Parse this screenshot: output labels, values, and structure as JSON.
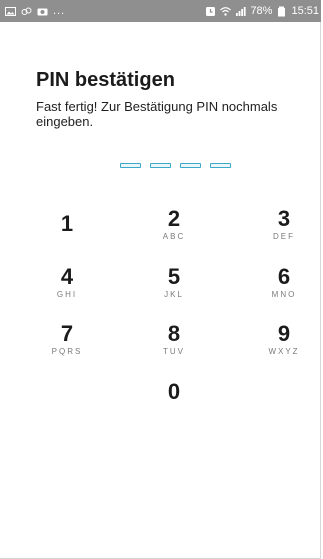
{
  "status_bar": {
    "dots": "...",
    "battery_text": "78%",
    "time": "15:51",
    "icons": [
      "image-icon",
      "link-icon",
      "camera-icon",
      "alarm-icon",
      "wifi-icon",
      "signal-icon",
      "battery-icon"
    ]
  },
  "screen": {
    "title": "PIN bestätigen",
    "subtitle": "Fast fertig! Zur Bestätigung PIN nochmals eingeben."
  },
  "pin": {
    "length": 4,
    "entered": 0
  },
  "keypad": {
    "k1": {
      "digit": "1",
      "letters": ""
    },
    "k2": {
      "digit": "2",
      "letters": "ABC"
    },
    "k3": {
      "digit": "3",
      "letters": "DEF"
    },
    "k4": {
      "digit": "4",
      "letters": "GHI"
    },
    "k5": {
      "digit": "5",
      "letters": "JKL"
    },
    "k6": {
      "digit": "6",
      "letters": "MNO"
    },
    "k7": {
      "digit": "7",
      "letters": "PQRS"
    },
    "k8": {
      "digit": "8",
      "letters": "TUV"
    },
    "k9": {
      "digit": "9",
      "letters": "WXYZ"
    },
    "k0": {
      "digit": "0",
      "letters": ""
    }
  },
  "colors": {
    "status_bar": "#8f8f8f",
    "accent": "#3da7c9",
    "text": "#1b1b1b",
    "subtext": "#7a7a7a"
  }
}
